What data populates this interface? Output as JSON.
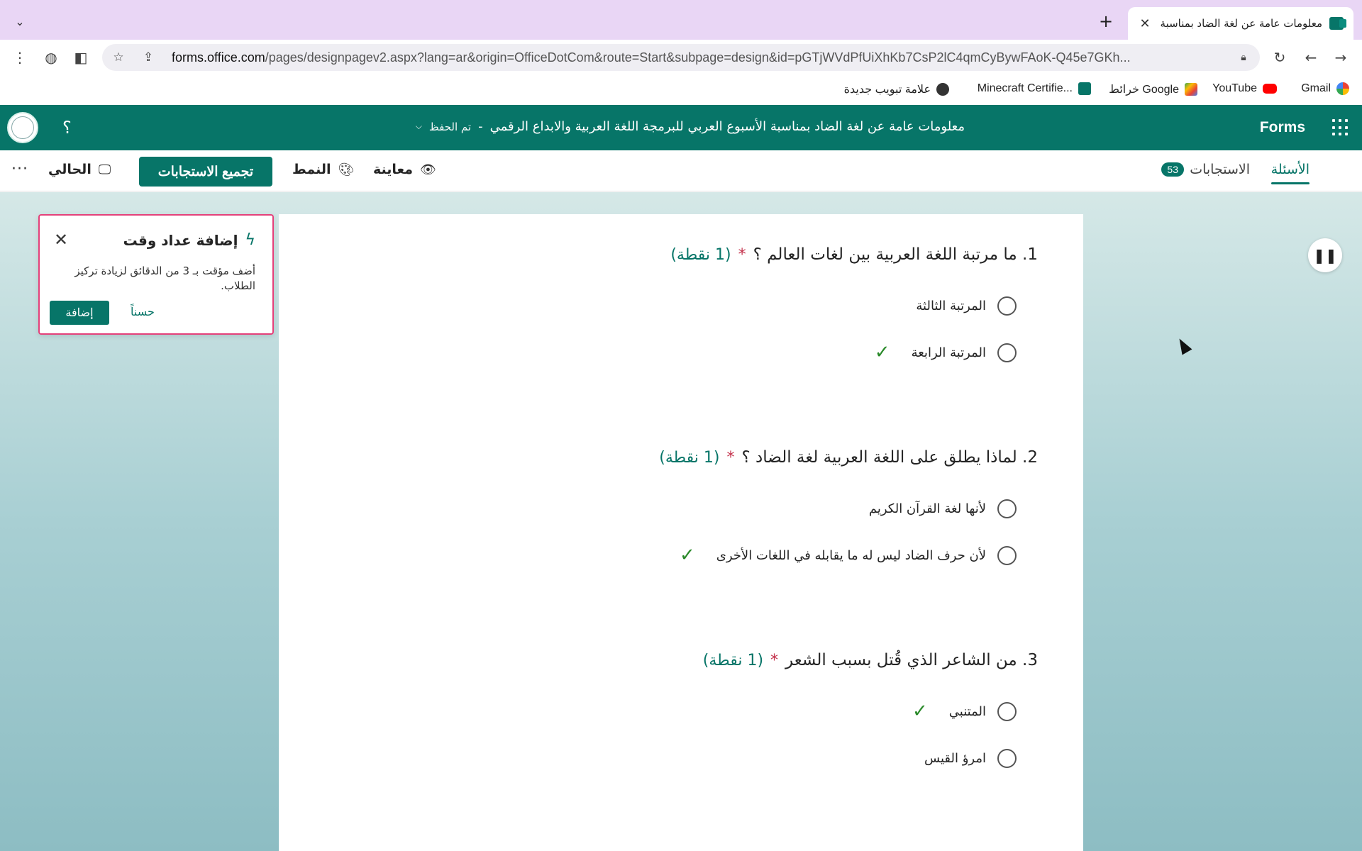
{
  "browser": {
    "tab_title": "معلومات عامة عن لغة الضاد  بمناسبة",
    "url_host": "forms.office.com",
    "url_path": "/pages/designpagev2.aspx?lang=ar&origin=OfficeDotCom&route=Start&subpage=design&id=pGTjWVdPfUiXhKb7CsP2lC4qmCyBywFAoK-Q45e7GKh..."
  },
  "bookmarks": [
    {
      "label": "Gmail",
      "icon": "google-icon"
    },
    {
      "label": "YouTube",
      "icon": "youtube-icon"
    },
    {
      "label": "خرائط Google",
      "icon": "maps-icon"
    },
    {
      "label": "Minecraft Certifie...",
      "icon": "forms-icon"
    },
    {
      "label": "علامة تبويب جديدة",
      "icon": "globe-icon"
    }
  ],
  "header": {
    "brand": "Forms",
    "form_title": "معلومات عامة عن لغة الضاد  بمناسبة الأسبوع العربي للبرمجة اللغة العربية والابداع الرقمي",
    "separator": "-",
    "save_status": "تم الحفظ",
    "help": "؟"
  },
  "commands": {
    "questions_tab": "الأسئلة",
    "responses_tab": "الاستجابات",
    "responses_count": "53",
    "preview": "معاينة",
    "style": "النمط",
    "collect": "تجميع الاستجابات",
    "present": "الحالي",
    "more": "···"
  },
  "popup": {
    "title": "إضافة عداد وقت",
    "body": "أضف مؤقت بـ 3 من الدقائق لزيادة تركيز الطلاب.",
    "add": "إضافة",
    "ok": "حسناً"
  },
  "questions": [
    {
      "title": "1. ما مرتبة اللغة العربية بين لغات العالم  ؟",
      "required": "*",
      "points": "(1 نقطة)",
      "options": [
        {
          "label": "المرتبة الثالثة",
          "correct": false
        },
        {
          "label": "المرتبة الرابعة",
          "correct": true
        }
      ]
    },
    {
      "title": "2. لماذا يطلق على اللغة العربية لغة الضاد ؟",
      "required": "*",
      "points": "(1 نقطة)",
      "options": [
        {
          "label": "لأنها لغة القرآن الكريم",
          "correct": false
        },
        {
          "label": "لأن حرف الضاد ليس له ما يقابله في اللغات الأخرى",
          "correct": true
        }
      ]
    },
    {
      "title": "3. من الشاعر الذي قُتل بسبب الشعر",
      "required": "*",
      "points": "(1 نقطة)",
      "options": [
        {
          "label": "المتنبي",
          "correct": true
        },
        {
          "label": "امرؤ القيس",
          "correct": false
        }
      ]
    }
  ],
  "colors": {
    "accent": "#077568",
    "required": "#c4314b",
    "correct": "#2a8a2a",
    "popup_border": "#e4407a",
    "tabstrip": "#e9d6f5"
  }
}
